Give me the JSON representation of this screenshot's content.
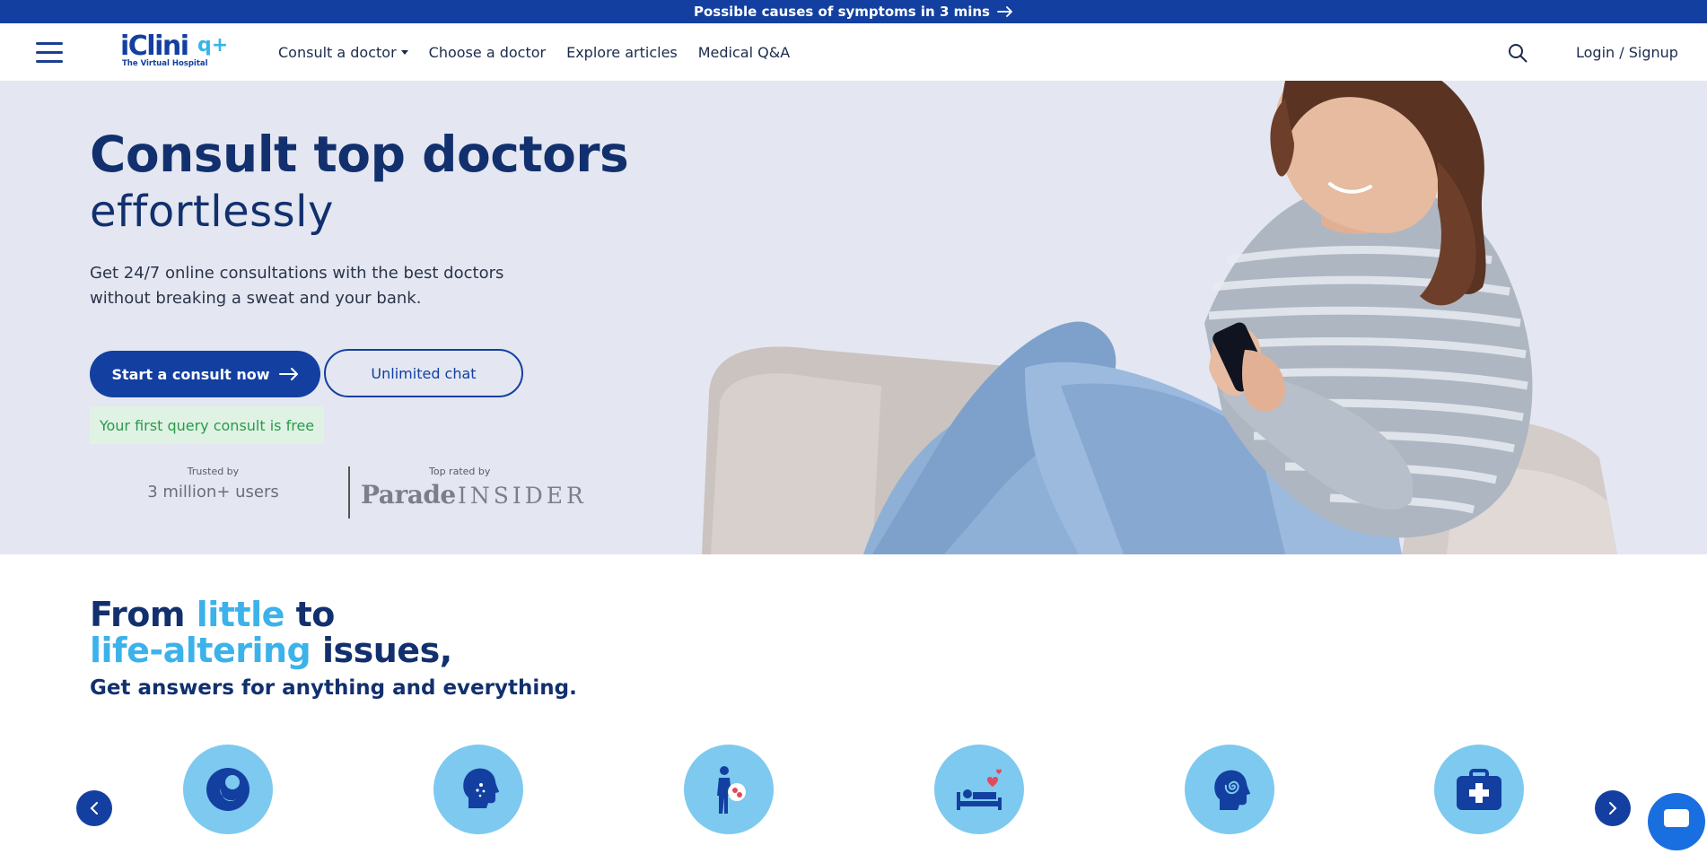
{
  "promo": {
    "text": "Possible causes of symptoms in 3 mins"
  },
  "nav": {
    "logo_word": "iClini",
    "logo_tag": "The Virtual Hospital",
    "items": [
      {
        "label": "Consult a doctor",
        "has_caret": true
      },
      {
        "label": "Choose a doctor"
      },
      {
        "label": "Explore articles"
      },
      {
        "label": "Medical Q&A"
      }
    ],
    "login": "Login / Signup"
  },
  "hero": {
    "title_line1": "Consult top doctors",
    "title_line2": "effortlessly",
    "subtitle": "Get 24/7 online consultations with the best doctors without breaking a sweat and your bank.",
    "primary_button": "Start a consult now",
    "secondary_button": "Unlimited chat",
    "free_note": "Your first query consult is free",
    "trusted_small": "Trusted by",
    "trusted_big": "3 million+ users",
    "rated_small": "Top rated by",
    "rated_brand1": "Parade",
    "rated_brand2": "INSIDER"
  },
  "section2": {
    "line1_a": "From ",
    "line1_hl": "little",
    "line1_b": " to",
    "line2_hl": "life-altering",
    "line2_b": " issues,",
    "tagline": "Get answers for anything and everything."
  },
  "categories": [
    {
      "icon": "fetus-icon"
    },
    {
      "icon": "head-skin-icon"
    },
    {
      "icon": "body-organ-icon"
    },
    {
      "icon": "bed-hearts-icon"
    },
    {
      "icon": "brain-spiral-icon"
    },
    {
      "icon": "first-aid-kit-icon"
    }
  ],
  "colors": {
    "brand": "#1340a0",
    "accent": "#3cb2ea",
    "hero_bg": "#e4e7f1",
    "free_bg": "#dff2e4",
    "free_text": "#2a9a4b"
  }
}
